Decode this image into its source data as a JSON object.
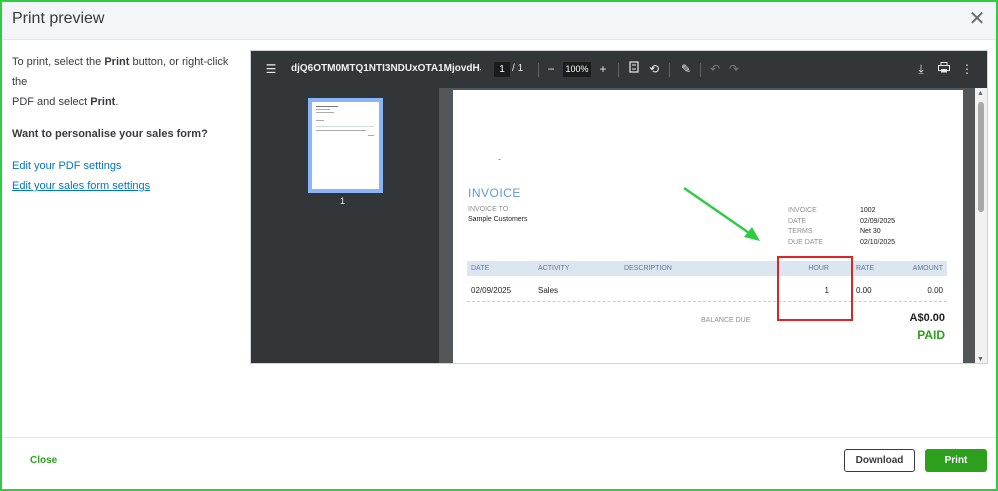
{
  "dialog": {
    "title": "Print preview",
    "close_icon": "close-icon"
  },
  "instructions": {
    "line1_a": "To print, select the ",
    "line1_b": "Print",
    "line1_c": " button, or right-click the",
    "line2_a": "PDF and select ",
    "line2_b": "Print",
    "line2_c": ".",
    "question": "Want to personalise your sales form?",
    "link_pdf_settings": "Edit your PDF settings",
    "link_form_settings": "Edit your sales form settings"
  },
  "pdf_viewer": {
    "filename": "djQ6OTM0MTQ1NTI3NDUxOTA1MjovdHJhbn...",
    "current_page": "1",
    "page_separator": "/",
    "total_pages": "1",
    "zoom": "100%",
    "thumbnail_page_number": "1",
    "icons": [
      "menu-icon",
      "zoom-out-icon",
      "zoom-in-icon",
      "fit-page-icon",
      "rotate-icon",
      "annotate-icon",
      "undo-icon",
      "redo-icon",
      "download-icon",
      "print-icon",
      "more-icon"
    ]
  },
  "invoice": {
    "dash": "-",
    "title": "INVOICE",
    "invoice_to_label": "INVOICE TO",
    "invoice_to_value": "Sample Customers",
    "meta": [
      {
        "label": "INVOICE",
        "value": "1002"
      },
      {
        "label": "DATE",
        "value": "02/09/2025"
      },
      {
        "label": "TERMS",
        "value": "Net 30"
      },
      {
        "label": "DUE DATE",
        "value": "02/10/2025"
      }
    ],
    "columns": [
      "DATE",
      "ACTIVITY",
      "DESCRIPTION",
      "HOUR",
      "RATE",
      "AMOUNT"
    ],
    "rows": [
      {
        "date": "02/09/2025",
        "activity": "Sales",
        "description": "",
        "hour": "1",
        "rate": "0.00",
        "amount": "0.00"
      }
    ],
    "balance_due_label": "BALANCE DUE",
    "balance_due_value": "A$0.00",
    "status": "PAID"
  },
  "colors": {
    "accent_green": "#2ca01c",
    "link_blue": "#0077c5",
    "annotation_red": "#e02424",
    "annotation_arrow": "#2ecc40"
  },
  "footer": {
    "close_label": "Close",
    "download_label": "Download",
    "print_label": "Print"
  }
}
